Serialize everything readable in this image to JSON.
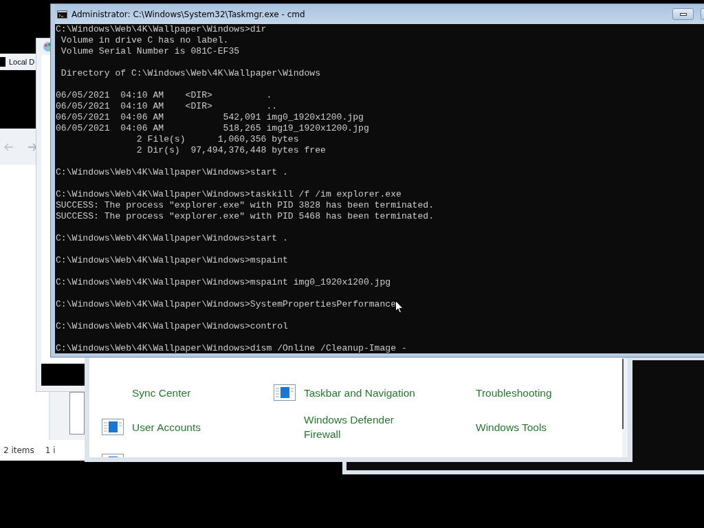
{
  "explorer": {
    "title": "Local D",
    "status_items": [
      "2 items",
      "1 i"
    ]
  },
  "control_panel": {
    "items": [
      {
        "label": "Sync Center",
        "has_icon": false
      },
      {
        "label": "Taskbar and Navigation",
        "has_icon": true
      },
      {
        "label": "Troubleshooting",
        "has_icon": false
      },
      {
        "label": "User Accounts",
        "has_icon": true
      },
      {
        "label": "Windows Defender Firewall",
        "has_icon": false
      },
      {
        "label": "Windows Tools",
        "has_icon": false
      }
    ]
  },
  "console": {
    "title": "Administrator: C:\\Windows\\System32\\Taskmgr.exe - cmd",
    "blocks": [
      [
        "C:\\Windows\\Web\\4K\\Wallpaper\\Windows>dir",
        " Volume in drive C has no label.",
        " Volume Serial Number is 081C-EF35"
      ],
      [
        " Directory of C:\\Windows\\Web\\4K\\Wallpaper\\Windows"
      ],
      [
        "06/05/2021  04:10 AM    <DIR>          .",
        "06/05/2021  04:10 AM    <DIR>          ..",
        "06/05/2021  04:06 AM           542,091 img0_1920x1200.jpg",
        "06/05/2021  04:06 AM           518,265 img19_1920x1200.jpg",
        "               2 File(s)      1,060,356 bytes",
        "               2 Dir(s)  97,494,376,448 bytes free"
      ],
      [
        "C:\\Windows\\Web\\4K\\Wallpaper\\Windows>start ."
      ],
      [
        "C:\\Windows\\Web\\4K\\Wallpaper\\Windows>taskkill /f /im explorer.exe",
        "SUCCESS: The process \"explorer.exe\" with PID 3828 has been terminated.",
        "SUCCESS: The process \"explorer.exe\" with PID 5468 has been terminated."
      ],
      [
        "C:\\Windows\\Web\\4K\\Wallpaper\\Windows>start ."
      ],
      [
        "C:\\Windows\\Web\\4K\\Wallpaper\\Windows>mspaint"
      ],
      [
        "C:\\Windows\\Web\\4K\\Wallpaper\\Windows>mspaint img0_1920x1200.jpg"
      ],
      [
        "C:\\Windows\\Web\\4K\\Wallpaper\\Windows>SystemPropertiesPerformance"
      ],
      [
        "C:\\Windows\\Web\\4K\\Wallpaper\\Windows>control"
      ],
      [
        "C:\\Windows\\Web\\4K\\Wallpaper\\Windows>dism /Online /Cleanup-Image -"
      ]
    ]
  }
}
